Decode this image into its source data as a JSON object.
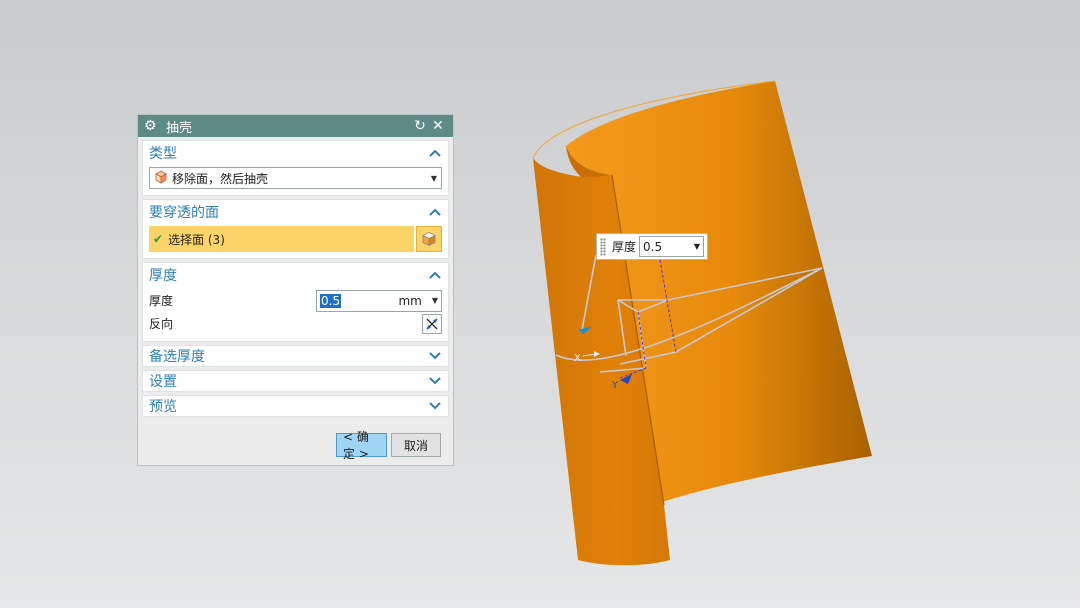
{
  "dialog": {
    "title": "抽壳",
    "sections": {
      "type": {
        "label": "类型",
        "dropdown_value": "移除面，然后抽壳"
      },
      "faces": {
        "label": "要穿透的面",
        "selection_label": "选择面 (3)"
      },
      "thickness": {
        "label": "厚度",
        "thickness_label": "厚度",
        "thickness_value": "0.5",
        "unit": "mm",
        "reverse_label": "反向"
      },
      "alt_thickness": {
        "label": "备选厚度"
      },
      "settings": {
        "label": "设置"
      },
      "preview": {
        "label": "预览"
      }
    },
    "buttons": {
      "ok": "< 确定 >",
      "cancel": "取消"
    }
  },
  "viewport": {
    "thickness_widget": {
      "label": "厚度",
      "value": "0.5"
    },
    "axis_labels": {
      "x": "X",
      "y": "Y"
    },
    "colors": {
      "surface": "#e8870a",
      "accent": "#2e7fb6",
      "selection": "#fbd468"
    }
  }
}
